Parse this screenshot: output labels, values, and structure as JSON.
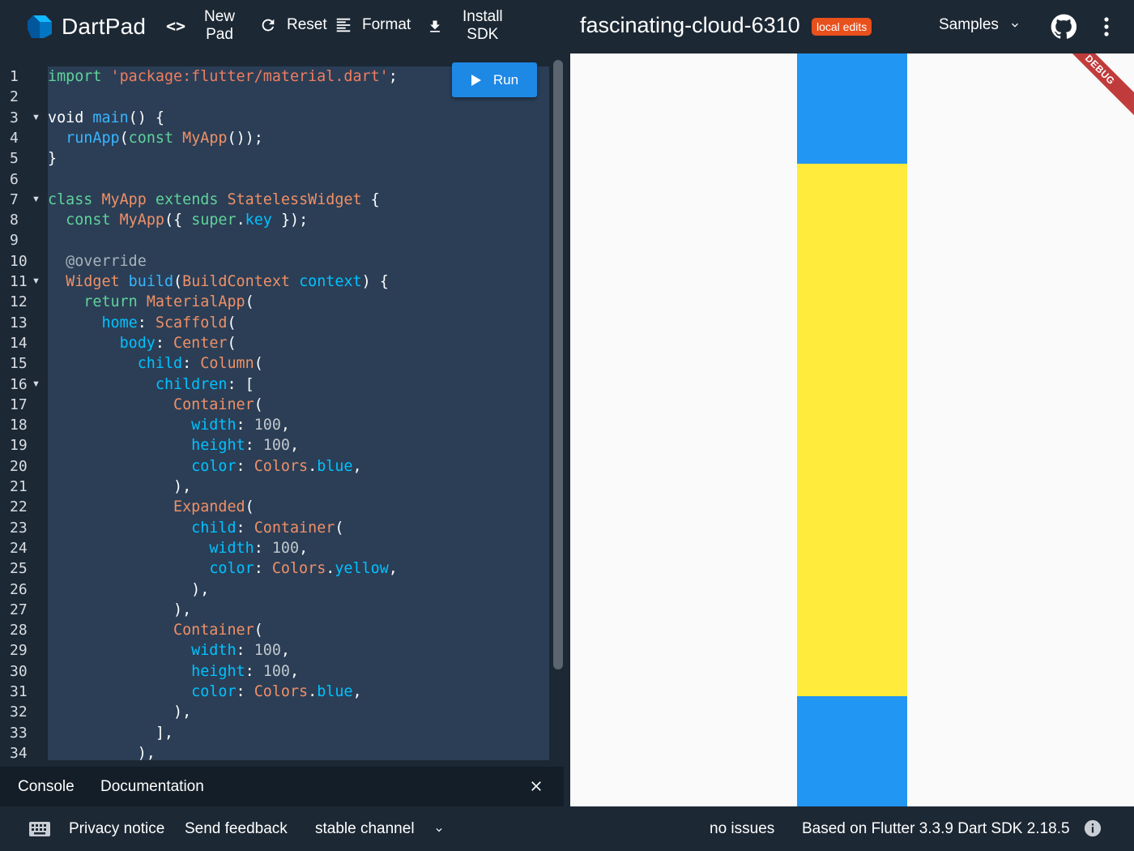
{
  "header": {
    "app_title": "DartPad",
    "embed_label": "<>",
    "new_pad_line1": "New",
    "new_pad_line2": "Pad",
    "reset_label": "Reset",
    "format_label": "Format",
    "install_line1": "Install",
    "install_line2": "SDK",
    "pad_title": "fascinating-cloud-6310",
    "badge": "local edits",
    "samples_label": "Samples",
    "brand_color": "#1c2834",
    "badge_color": "#e8501c"
  },
  "editor": {
    "run_label": "Run",
    "line_numbers": [
      "1",
      "2",
      "3",
      "4",
      "5",
      "6",
      "7",
      "8",
      "9",
      "10",
      "11",
      "12",
      "13",
      "14",
      "15",
      "16",
      "17",
      "18",
      "19",
      "20",
      "21",
      "22",
      "23",
      "24",
      "25",
      "26",
      "27",
      "28",
      "29",
      "30",
      "31",
      "32",
      "33",
      "34"
    ],
    "folded_lines": [
      "3",
      "7",
      "11",
      "16"
    ],
    "lines": [
      [
        [
          "k",
          "import"
        ],
        [
          "w",
          " "
        ],
        [
          "s",
          "'package:flutter/material.dart'"
        ],
        [
          "w",
          ";"
        ]
      ],
      [],
      [
        [
          "w",
          "void "
        ],
        [
          "f",
          "main"
        ],
        [
          "w",
          "() {"
        ]
      ],
      [
        [
          "w",
          "  "
        ],
        [
          "f",
          "runApp"
        ],
        [
          "w",
          "("
        ],
        [
          "k",
          "const"
        ],
        [
          "w",
          " "
        ],
        [
          "t",
          "MyApp"
        ],
        [
          "w",
          "());"
        ]
      ],
      [
        [
          "w",
          "}"
        ]
      ],
      [],
      [
        [
          "k",
          "class"
        ],
        [
          "w",
          " "
        ],
        [
          "t",
          "MyApp"
        ],
        [
          "w",
          " "
        ],
        [
          "k",
          "extends"
        ],
        [
          "w",
          " "
        ],
        [
          "t",
          "StatelessWidget"
        ],
        [
          "w",
          " {"
        ]
      ],
      [
        [
          "w",
          "  "
        ],
        [
          "k",
          "const"
        ],
        [
          "w",
          " "
        ],
        [
          "t",
          "MyApp"
        ],
        [
          "w",
          "({ "
        ],
        [
          "k",
          "super"
        ],
        [
          "w",
          "."
        ],
        [
          "p",
          "key"
        ],
        [
          "w",
          " });"
        ]
      ],
      [],
      [
        [
          "w",
          "  "
        ],
        [
          "c",
          "@override"
        ]
      ],
      [
        [
          "w",
          "  "
        ],
        [
          "t",
          "Widget"
        ],
        [
          "w",
          " "
        ],
        [
          "f",
          "build"
        ],
        [
          "w",
          "("
        ],
        [
          "t",
          "BuildContext"
        ],
        [
          "w",
          " "
        ],
        [
          "p",
          "context"
        ],
        [
          "w",
          ") {"
        ]
      ],
      [
        [
          "w",
          "    "
        ],
        [
          "k",
          "return"
        ],
        [
          "w",
          " "
        ],
        [
          "t",
          "MaterialApp"
        ],
        [
          "w",
          "("
        ]
      ],
      [
        [
          "w",
          "      "
        ],
        [
          "p",
          "home"
        ],
        [
          "w",
          ": "
        ],
        [
          "t",
          "Scaffold"
        ],
        [
          "w",
          "("
        ]
      ],
      [
        [
          "w",
          "        "
        ],
        [
          "p",
          "body"
        ],
        [
          "w",
          ": "
        ],
        [
          "t",
          "Center"
        ],
        [
          "w",
          "("
        ]
      ],
      [
        [
          "w",
          "          "
        ],
        [
          "p",
          "child"
        ],
        [
          "w",
          ": "
        ],
        [
          "t",
          "Column"
        ],
        [
          "w",
          "("
        ]
      ],
      [
        [
          "w",
          "            "
        ],
        [
          "p",
          "children"
        ],
        [
          "w",
          ": ["
        ]
      ],
      [
        [
          "w",
          "              "
        ],
        [
          "t",
          "Container"
        ],
        [
          "w",
          "("
        ]
      ],
      [
        [
          "w",
          "                "
        ],
        [
          "p",
          "width"
        ],
        [
          "w",
          ": "
        ],
        [
          "n",
          "100"
        ],
        [
          "w",
          ","
        ]
      ],
      [
        [
          "w",
          "                "
        ],
        [
          "p",
          "height"
        ],
        [
          "w",
          ": "
        ],
        [
          "n",
          "100"
        ],
        [
          "w",
          ","
        ]
      ],
      [
        [
          "w",
          "                "
        ],
        [
          "p",
          "color"
        ],
        [
          "w",
          ": "
        ],
        [
          "t",
          "Colors"
        ],
        [
          "w",
          "."
        ],
        [
          "p",
          "blue"
        ],
        [
          "w",
          ","
        ]
      ],
      [
        [
          "w",
          "              ),"
        ]
      ],
      [
        [
          "w",
          "              "
        ],
        [
          "t",
          "Expanded"
        ],
        [
          "w",
          "("
        ]
      ],
      [
        [
          "w",
          "                "
        ],
        [
          "p",
          "child"
        ],
        [
          "w",
          ": "
        ],
        [
          "t",
          "Container"
        ],
        [
          "w",
          "("
        ]
      ],
      [
        [
          "w",
          "                  "
        ],
        [
          "p",
          "width"
        ],
        [
          "w",
          ": "
        ],
        [
          "n",
          "100"
        ],
        [
          "w",
          ","
        ]
      ],
      [
        [
          "w",
          "                  "
        ],
        [
          "p",
          "color"
        ],
        [
          "w",
          ": "
        ],
        [
          "t",
          "Colors"
        ],
        [
          "w",
          "."
        ],
        [
          "p",
          "yellow"
        ],
        [
          "w",
          ","
        ]
      ],
      [
        [
          "w",
          "                ),"
        ]
      ],
      [
        [
          "w",
          "              ),"
        ]
      ],
      [
        [
          "w",
          "              "
        ],
        [
          "t",
          "Container"
        ],
        [
          "w",
          "("
        ]
      ],
      [
        [
          "w",
          "                "
        ],
        [
          "p",
          "width"
        ],
        [
          "w",
          ": "
        ],
        [
          "n",
          "100"
        ],
        [
          "w",
          ","
        ]
      ],
      [
        [
          "w",
          "                "
        ],
        [
          "p",
          "height"
        ],
        [
          "w",
          ": "
        ],
        [
          "n",
          "100"
        ],
        [
          "w",
          ","
        ]
      ],
      [
        [
          "w",
          "                "
        ],
        [
          "p",
          "color"
        ],
        [
          "w",
          ": "
        ],
        [
          "t",
          "Colors"
        ],
        [
          "w",
          "."
        ],
        [
          "p",
          "blue"
        ],
        [
          "w",
          ","
        ]
      ],
      [
        [
          "w",
          "              ),"
        ]
      ],
      [
        [
          "w",
          "            ],"
        ]
      ],
      [
        [
          "w",
          "          ),"
        ]
      ]
    ]
  },
  "bottom_panel": {
    "console_tab": "Console",
    "docs_tab": "Documentation"
  },
  "preview": {
    "debug_label": "DEBUG",
    "blue_color": "#2196f3",
    "yellow_color": "#ffeb3b"
  },
  "footer": {
    "privacy": "Privacy notice",
    "feedback": "Send feedback",
    "channel": "stable channel",
    "issues": "no issues",
    "sdk_info": "Based on Flutter 3.3.9 Dart SDK 2.18.5"
  }
}
